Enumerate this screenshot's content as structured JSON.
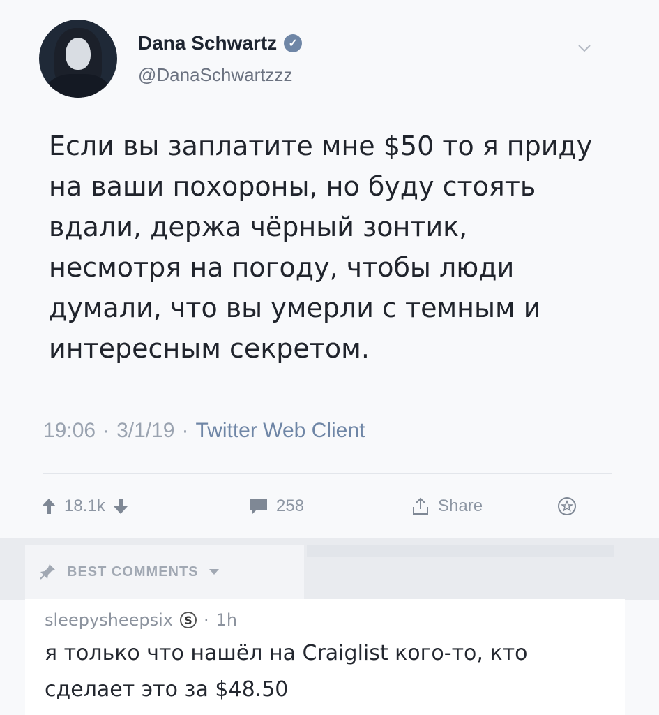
{
  "tweet": {
    "author_name": "Dana Schwartz",
    "author_handle": "@DanaSchwartzzz",
    "verified_mark": "✓",
    "text": "Если вы заплатите мне $50 то я приду на ваши похороны, но буду стоять вдали, держа чёрный зонтик, несмотря на погоду, чтобы люди думали, что вы умерли с темным и интересным секретом.",
    "time": "19:06",
    "date": "3/1/19",
    "client": "Twitter Web Client",
    "separator": "·"
  },
  "actions": {
    "upvotes": "18.1k",
    "replies": "258",
    "share_label": "Share"
  },
  "comments": {
    "section_label": "BEST COMMENTS",
    "items": [
      {
        "username": "sleepysheepsix",
        "badge": "S",
        "age": "1h",
        "text": "я только что нашёл на Craiglist кого-то, кто сделает это за $48.50"
      }
    ]
  },
  "icons": {
    "verified": "verified-badge-icon",
    "chevron": "chevron-down-icon",
    "upvote": "arrow-up-icon",
    "downvote": "arrow-down-icon",
    "reply": "comment-icon",
    "share": "share-icon",
    "favorite": "star-icon",
    "comments": "pin-icon"
  },
  "colors": {
    "accent": "#6f86a6",
    "text": "#20242c",
    "muted": "#9aa3b0"
  }
}
